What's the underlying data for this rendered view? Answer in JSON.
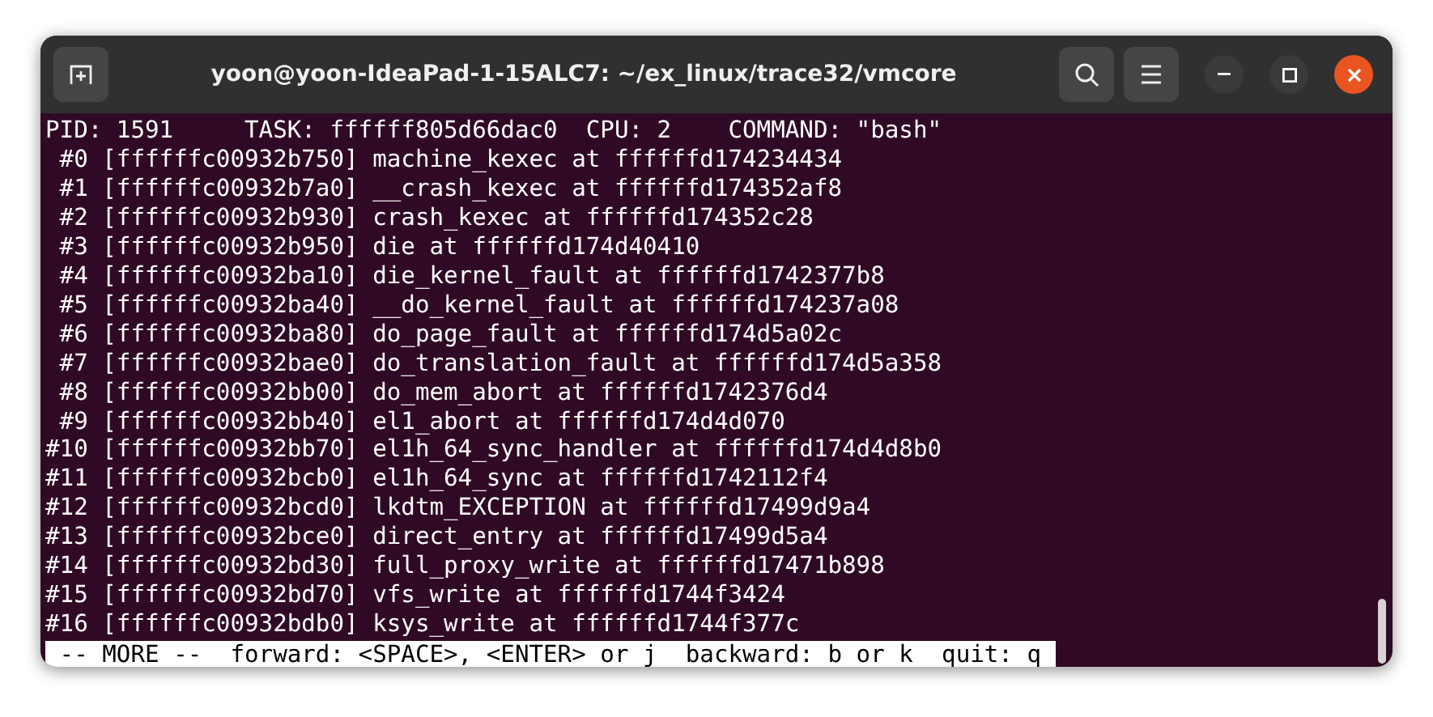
{
  "window": {
    "title": "yoon@yoon-IdeaPad-1-15ALC7: ~/ex_linux/trace32/vmcore"
  },
  "lines": [
    "PID: 1591     TASK: ffffff805d66dac0  CPU: 2    COMMAND: \"bash\"",
    " #0 [ffffffc00932b750] machine_kexec at ffffffd174234434",
    " #1 [ffffffc00932b7a0] __crash_kexec at ffffffd174352af8",
    " #2 [ffffffc00932b930] crash_kexec at ffffffd174352c28",
    " #3 [ffffffc00932b950] die at ffffffd174d40410",
    " #4 [ffffffc00932ba10] die_kernel_fault at ffffffd1742377b8",
    " #5 [ffffffc00932ba40] __do_kernel_fault at ffffffd174237a08",
    " #6 [ffffffc00932ba80] do_page_fault at ffffffd174d5a02c",
    " #7 [ffffffc00932bae0] do_translation_fault at ffffffd174d5a358",
    " #8 [ffffffc00932bb00] do_mem_abort at ffffffd1742376d4",
    " #9 [ffffffc00932bb40] el1_abort at ffffffd174d4d070",
    "#10 [ffffffc00932bb70] el1h_64_sync_handler at ffffffd174d4d8b0",
    "#11 [ffffffc00932bcb0] el1h_64_sync at ffffffd1742112f4",
    "#12 [ffffffc00932bcd0] lkdtm_EXCEPTION at ffffffd17499d9a4",
    "#13 [ffffffc00932bce0] direct_entry at ffffffd17499d5a4",
    "#14 [ffffffc00932bd30] full_proxy_write at ffffffd17471b898",
    "#15 [ffffffc00932bd70] vfs_write at ffffffd1744f3424",
    "#16 [ffffffc00932bdb0] ksys_write at ffffffd1744f377c"
  ],
  "pager_prompt": " -- MORE --  forward: <SPACE>, <ENTER> or j  backward: b or k  quit: q "
}
